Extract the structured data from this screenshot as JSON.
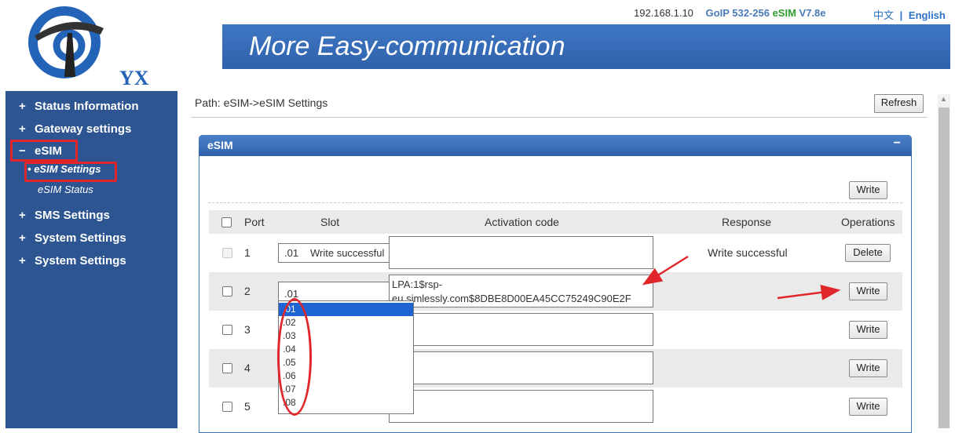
{
  "header": {
    "logo_text": "YX",
    "ip": "192.168.1.10",
    "model_prefix": "GoIP 532-256",
    "model_esim": "eSIM",
    "model_version": "V7.8e",
    "lang_zh": "中文",
    "lang_sep": "|",
    "lang_en": "English",
    "banner_title": "More Easy-communication",
    "brand_color": "#2f62ad"
  },
  "sidebar": {
    "items": [
      {
        "toggle": "+",
        "label": "Status Information"
      },
      {
        "toggle": "+",
        "label": "Gateway settings"
      },
      {
        "toggle": "−",
        "label": "eSIM"
      },
      {
        "toggle": "+",
        "label": "SMS Settings"
      },
      {
        "toggle": "+",
        "label": "System Settings"
      },
      {
        "toggle": "+",
        "label": "System Settings"
      }
    ],
    "sub_items": [
      {
        "bullet": "•",
        "label": "eSIM Settings"
      },
      {
        "label": "eSIM Status"
      }
    ],
    "highlight_color": "#e0262a"
  },
  "main": {
    "path": "Path: eSIM->eSIM Settings",
    "refresh_label": "Refresh",
    "panel_title": "eSIM",
    "panel_toggle": "−",
    "write_all_label": "Write",
    "columns": [
      "Port",
      "Slot",
      "Activation code",
      "Response",
      "Operations"
    ],
    "rows": [
      {
        "port": "1",
        "slot": ".01",
        "slot_status": "Write successful",
        "activation": "",
        "response": "Write successful",
        "operation": "Delete"
      },
      {
        "port": "2",
        "slot": ".01",
        "activation_line1": "LPA:1$rsp-",
        "activation_line2": "eu.simlessly.com$8DBE8D00EA45CC75249C90E2F",
        "response": "",
        "operation": "Write"
      },
      {
        "port": "3",
        "slot": "",
        "activation": "",
        "response": "",
        "operation": "Write"
      },
      {
        "port": "4",
        "slot": "",
        "activation": "",
        "response": "",
        "operation": "Write"
      },
      {
        "port": "5",
        "slot": "",
        "activation": "",
        "response": "",
        "operation": "Write"
      }
    ],
    "slot_options": [
      ".01",
      ".02",
      ".03",
      ".04",
      ".05",
      ".06",
      ".07",
      ".08"
    ],
    "selected_option": ".01"
  }
}
